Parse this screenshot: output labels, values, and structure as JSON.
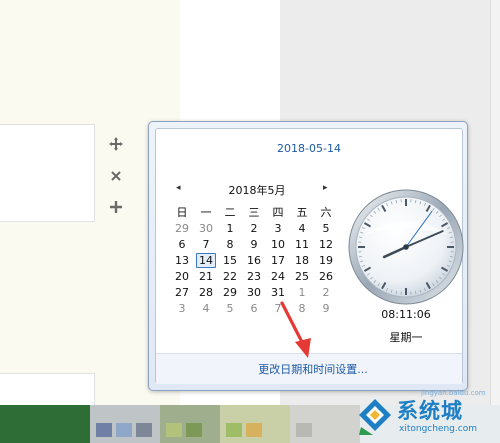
{
  "popup": {
    "date_header": "2018-05-14",
    "month_title": "2018年5月",
    "prev_icon": "◂",
    "next_icon": "▸",
    "weekdays": [
      "日",
      "一",
      "二",
      "三",
      "四",
      "五",
      "六"
    ],
    "weeks": [
      [
        "29",
        "30",
        "1",
        "2",
        "3",
        "4",
        "5"
      ],
      [
        "6",
        "7",
        "8",
        "9",
        "10",
        "11",
        "12"
      ],
      [
        "13",
        "14",
        "15",
        "16",
        "17",
        "18",
        "19"
      ],
      [
        "20",
        "21",
        "22",
        "23",
        "24",
        "25",
        "26"
      ],
      [
        "27",
        "28",
        "29",
        "30",
        "31",
        "1",
        "2"
      ],
      [
        "3",
        "4",
        "5",
        "6",
        "7",
        "8",
        "9"
      ]
    ],
    "selected_day": "14",
    "clock": {
      "time": "08:11:06",
      "day": "星期一",
      "hour": 8,
      "minute": 11,
      "second": 6
    },
    "footer_link": "更改日期和时间设置..."
  },
  "toolbar": {
    "move_icon": "move-icon",
    "close_icon": "close-icon",
    "add_icon": "plus-icon"
  },
  "watermark": {
    "brand": "系统城",
    "url": "xitongcheng.com",
    "small": "jingyan.baidu.com"
  },
  "colors": {
    "link": "#1e5aa8",
    "accent": "#3c78c8",
    "arrow": "#e53935",
    "watermark": "#1f7fc4"
  }
}
